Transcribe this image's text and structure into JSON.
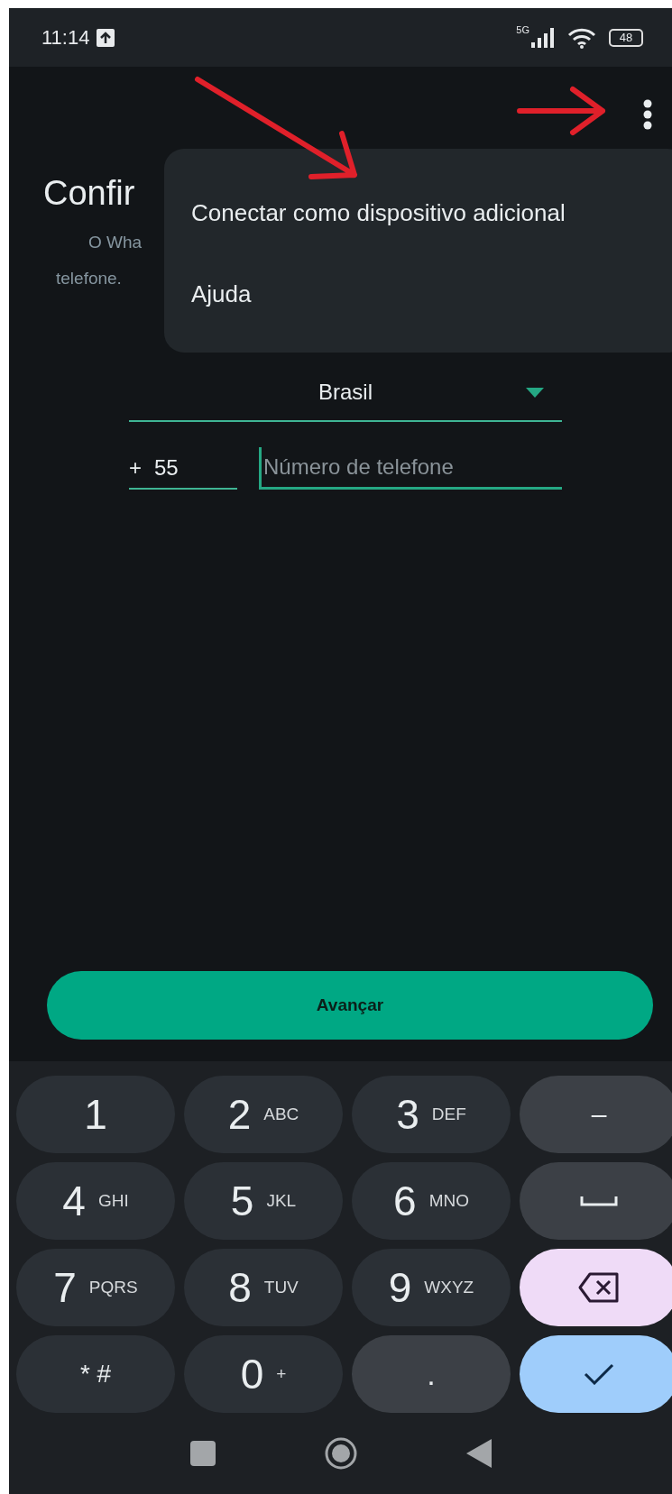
{
  "status_bar": {
    "time": "11:14",
    "network": "5G",
    "battery": "48"
  },
  "menu": {
    "items": [
      {
        "label": "Conectar como dispositivo adicional"
      },
      {
        "label": "Ajuda"
      }
    ]
  },
  "title": "Confir",
  "description_lines": [
    "O Wha",
    "telefone."
  ],
  "country": {
    "value": "Brasil"
  },
  "phone": {
    "prefix": "+",
    "code": "55",
    "placeholder": "Número de telefone"
  },
  "next_button": "Avançar",
  "keypad": [
    {
      "kind": "digit",
      "label": "1"
    },
    {
      "kind": "digit",
      "label": "2",
      "letters": "ABC"
    },
    {
      "kind": "digit",
      "label": "3",
      "letters": "DEF"
    },
    {
      "kind": "symbol",
      "label": "–"
    },
    {
      "kind": "digit",
      "label": "4",
      "letters": "GHI"
    },
    {
      "kind": "digit",
      "label": "5",
      "letters": "JKL"
    },
    {
      "kind": "digit",
      "label": "6",
      "letters": "MNO"
    },
    {
      "kind": "space"
    },
    {
      "kind": "digit",
      "label": "7",
      "letters": "PQRS"
    },
    {
      "kind": "digit",
      "label": "8",
      "letters": "TUV"
    },
    {
      "kind": "digit",
      "label": "9",
      "letters": "WXYZ"
    },
    {
      "kind": "backspace"
    },
    {
      "kind": "small",
      "label": "* #"
    },
    {
      "kind": "digit",
      "label": "0",
      "letters": "+"
    },
    {
      "kind": "symbol",
      "label": "."
    },
    {
      "kind": "done"
    }
  ]
}
